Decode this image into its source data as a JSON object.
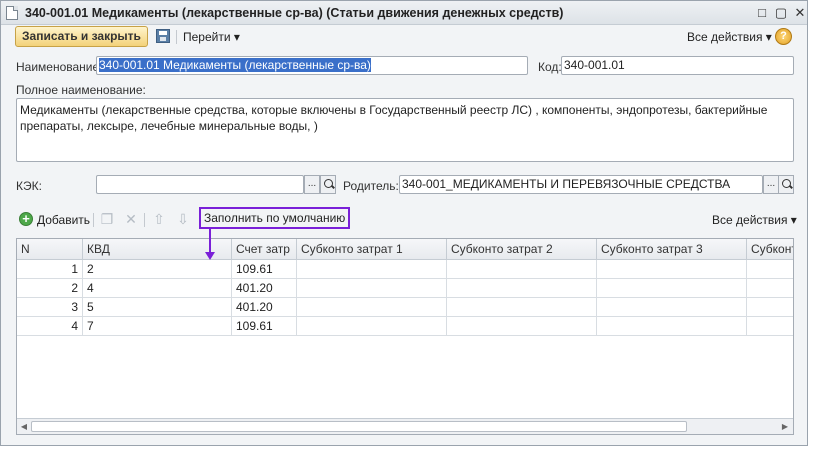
{
  "window": {
    "title": "340-001.01 Медикаменты (лекарственные ср-ва) (Статьи движения денежных средств)",
    "buttons": [
      "□",
      "▢",
      "✕"
    ]
  },
  "toolbar": {
    "save_close_label": "Записать и закрыть",
    "goto_label": "Перейти ▾",
    "all_actions_label": "Все действия ▾",
    "help_label": "?"
  },
  "form": {
    "name_label": "Наименование:",
    "name_value": "340-001.01 Медикаменты (лекарственные ср-ва)",
    "code_label": "Код:",
    "code_value": "340-001.01",
    "fullname_label": "Полное наименование:",
    "fullname_value": "Медикаменты (лекарственные средства, которые включены в Государственный реестр ЛС) , компоненты, эндопротезы, бактерийные препараты, лексыре, лечебные минеральные воды, )",
    "kek_label": "КЭК:",
    "kek_value": "",
    "kek_picker": "...",
    "parent_label": "Родитель:",
    "parent_value": "340-001_МЕДИКАМЕНТЫ И ПЕРЕВЯЗОЧНЫЕ СРЕДСТВА",
    "parent_picker": "..."
  },
  "table_toolbar": {
    "add_label": "Добавить",
    "fill_default_label": "Заполнить по умолчанию",
    "all_actions_label": "Все действия ▾"
  },
  "table": {
    "columns": [
      "N",
      "КВД",
      "Счет затр",
      "Субконто затрат 1",
      "Субконто затрат 2",
      "Субконто затрат 3",
      "Субконто"
    ],
    "rows": [
      {
        "n": "1",
        "kvd": "2",
        "account": "109.61",
        "s1": "",
        "s2": "",
        "s3": "",
        "s4": ""
      },
      {
        "n": "2",
        "kvd": "4",
        "account": "401.20",
        "s1": "",
        "s2": "",
        "s3": "",
        "s4": ""
      },
      {
        "n": "3",
        "kvd": "5",
        "account": "401.20",
        "s1": "",
        "s2": "",
        "s3": "",
        "s4": ""
      },
      {
        "n": "4",
        "kvd": "7",
        "account": "109.61",
        "s1": "",
        "s2": "",
        "s3": "",
        "s4": ""
      }
    ]
  },
  "colors": {
    "highlight": "#7a20d8",
    "primary_button": "#f3d27a",
    "selection": "#3a6fc9"
  },
  "icons": [
    "document-icon",
    "save-icon",
    "help-icon",
    "add-icon",
    "copy-icon",
    "delete-icon",
    "move-up-icon",
    "move-down-icon",
    "search-icon"
  ]
}
